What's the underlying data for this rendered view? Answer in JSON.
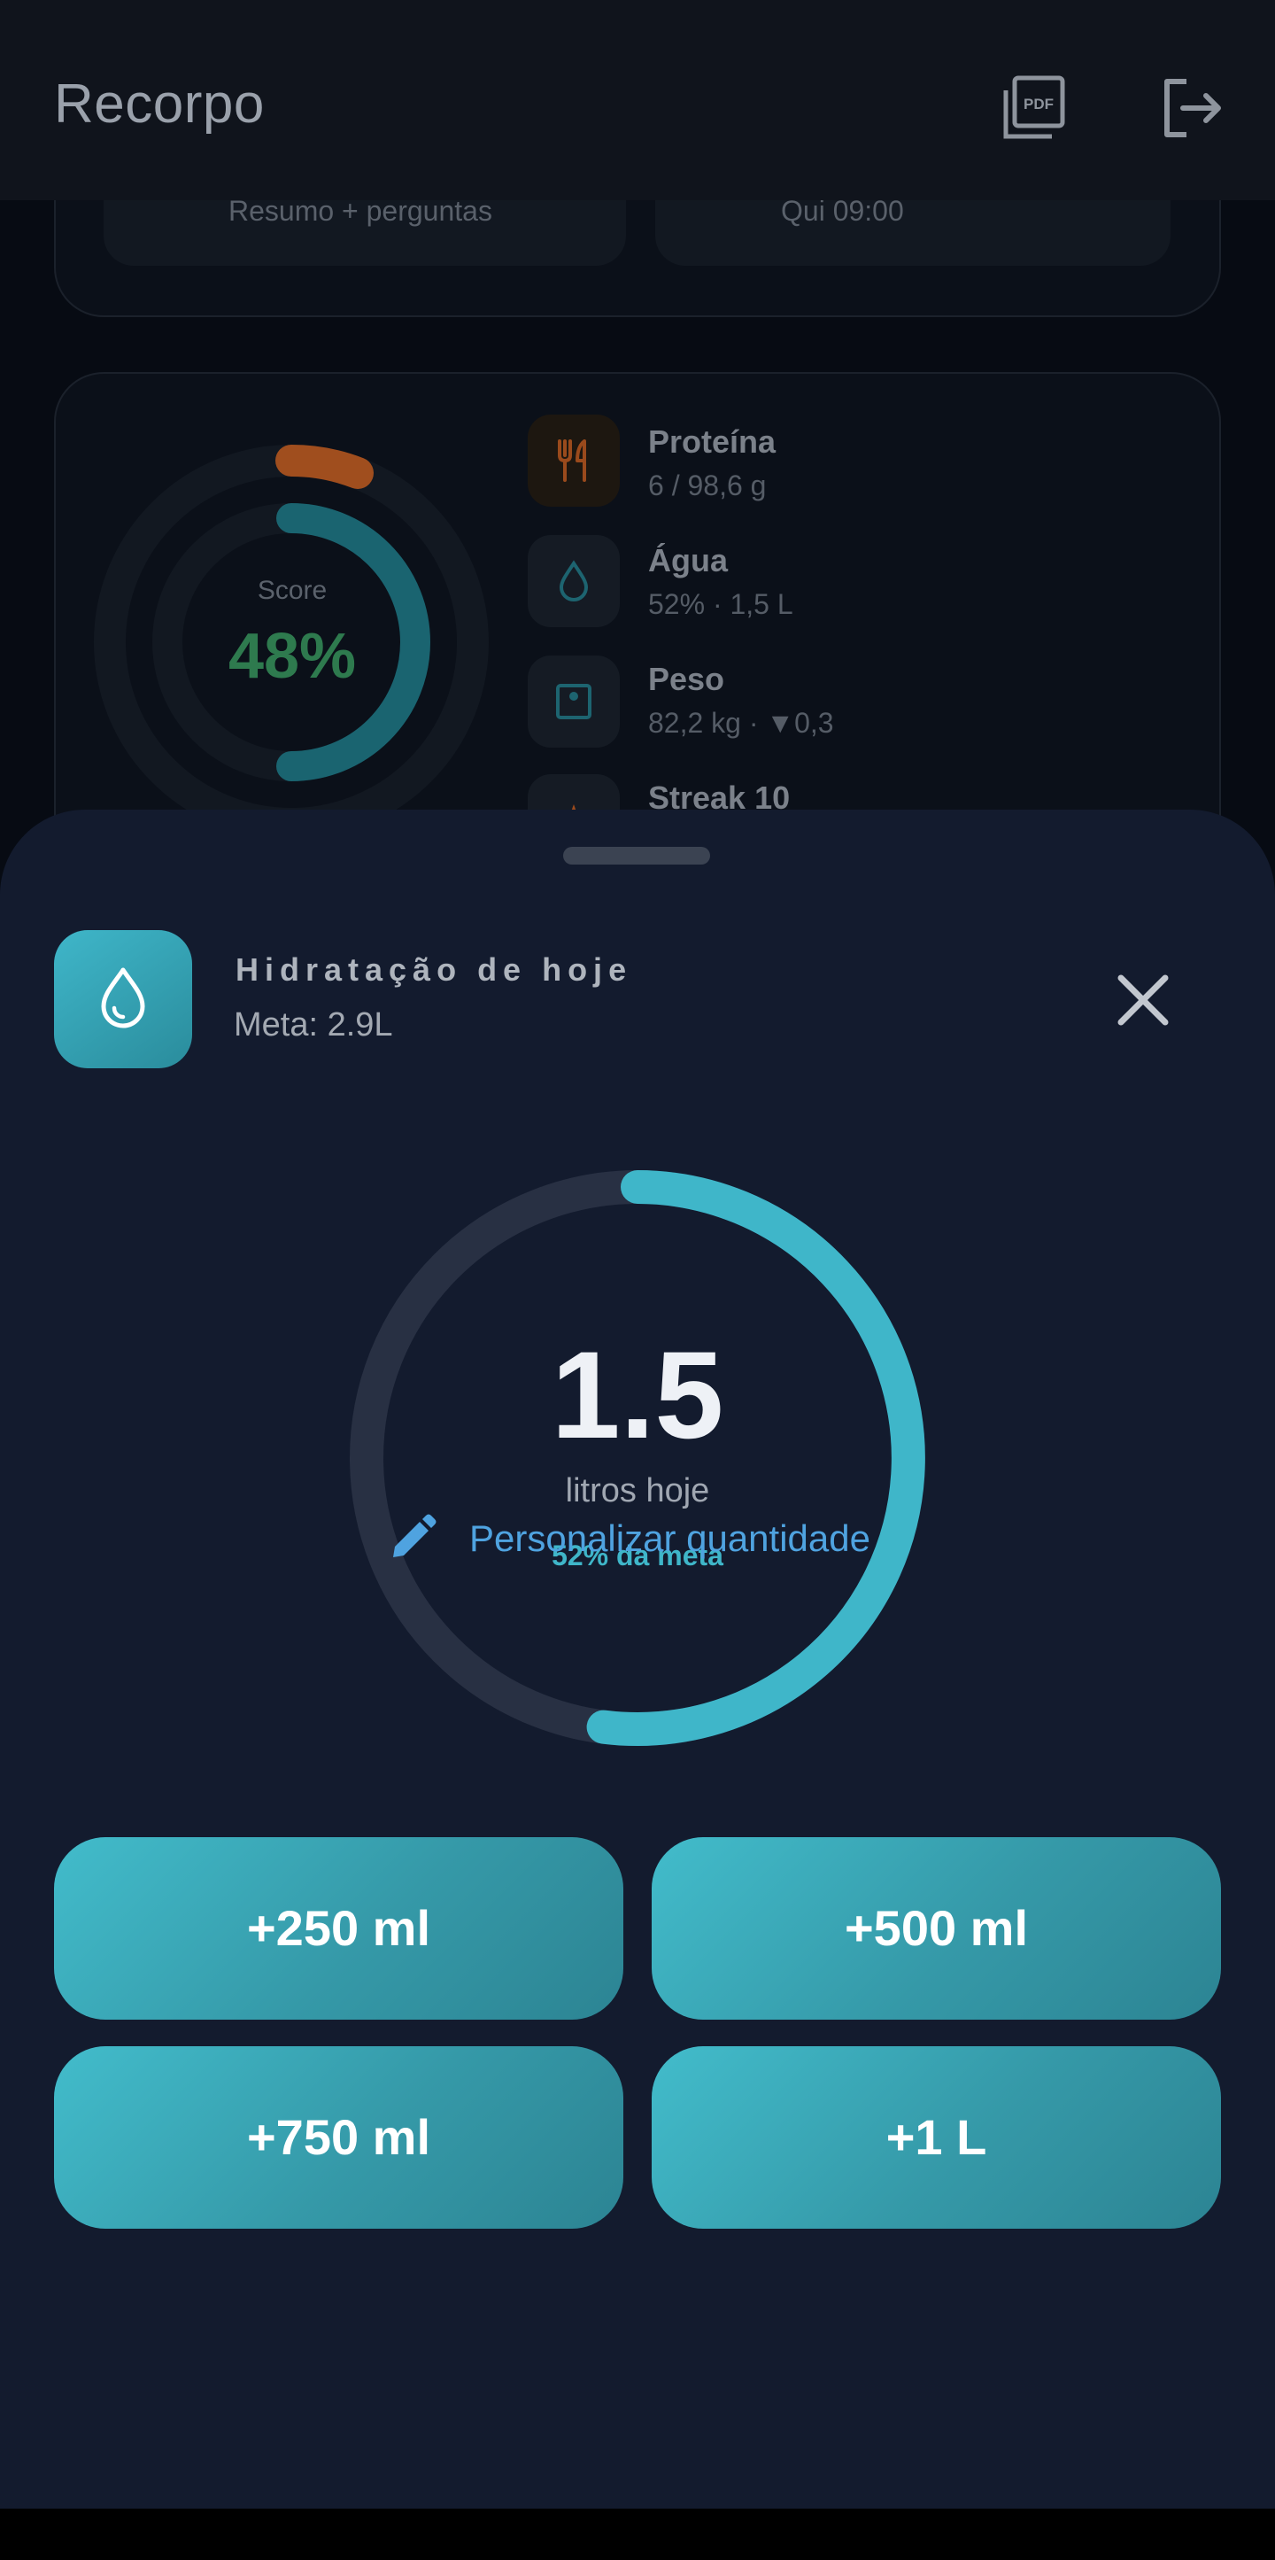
{
  "appbar": {
    "title": "Recorpo",
    "icons": [
      "pdf-icon",
      "logout-icon"
    ]
  },
  "top_card": {
    "tiles": [
      {
        "subtitle": "Resumo + perguntas"
      },
      {
        "subtitle": "Qui 09:00"
      }
    ]
  },
  "score_card": {
    "label": "Score",
    "value": "48%",
    "stats": [
      {
        "name": "Proteína",
        "detail": "6 / 98,6 g",
        "icon": "fork-knife-icon"
      },
      {
        "name": "Água",
        "detail": "52% · 1,5 L",
        "icon": "water-drop-icon"
      },
      {
        "name": "Peso",
        "detail": "82,2 kg · ▼0,3",
        "icon": "scale-icon"
      },
      {
        "name": "Streak 10",
        "detail": "",
        "icon": "flame-icon"
      }
    ]
  },
  "sheet": {
    "title": "Hidratação de hoje",
    "subtitle": "Meta: 2.9L",
    "progress": {
      "value": "1.5",
      "unit": "litros hoje",
      "percent_label": "52% da meta",
      "fraction": 0.52
    },
    "quick_buttons": [
      {
        "label": "+250 ml"
      },
      {
        "label": "+500 ml"
      },
      {
        "label": "+750 ml"
      },
      {
        "label": "+1 L"
      }
    ],
    "custom_label": "Personalizar quantidade"
  },
  "colors": {
    "accent": "#3fb6c9",
    "sheet_bg": "#131b2e",
    "link": "#4fa3e0",
    "score_green": "#2e7a4e",
    "protein_orange": "#a04e1e"
  }
}
